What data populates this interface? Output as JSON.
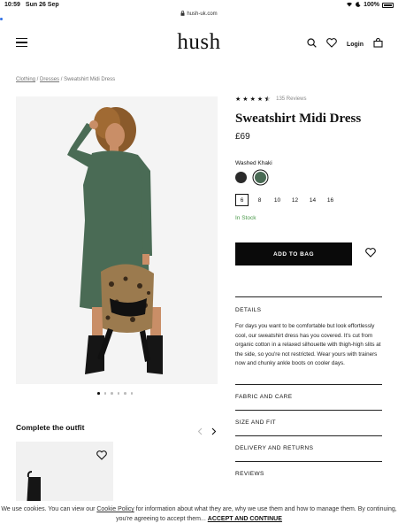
{
  "status": {
    "time": "10:59",
    "date": "Sun 26 Sep",
    "battery": "100%"
  },
  "browser": {
    "url": "hush-uk.com"
  },
  "header": {
    "logo": "hush",
    "login_label": "Login"
  },
  "breadcrumb": {
    "items": [
      "Clothing",
      "Dresses",
      "Sweatshirt Midi Dress"
    ],
    "sep": " / "
  },
  "product": {
    "rating_stars": 4.5,
    "reviews": "135 Reviews",
    "title": "Sweatshirt Midi Dress",
    "price": "£69",
    "color_label": "Washed Khaki",
    "swatch_colors": [
      "#2a2a2a",
      "#4a6b55"
    ],
    "sizes": [
      "6",
      "8",
      "10",
      "12",
      "14",
      "16"
    ],
    "selected_size": "6",
    "stock": "In Stock",
    "add_to_bag": "ADD TO BAG",
    "image_count": 6,
    "image_active": 1
  },
  "accordion": {
    "details_label": "DETAILS",
    "details_text": "For days you want to be comfortable but look effortlessly cool, our sweatshirt dress has you covered. It's cut from organic cotton in a relaxed silhouette with thigh-high slits at the side, so you're not restricted. Wear yours with trainers now and chunky ankle boots on cooler days.",
    "fabric_label": "FABRIC AND CARE",
    "size_label": "SIZE AND FIT",
    "delivery_label": "DELIVERY AND RETURNS",
    "reviews_label": "REVIEWS"
  },
  "outfit": {
    "title": "Complete the outfit"
  },
  "cookie": {
    "text1": "We use cookies. You can view our ",
    "link": "Cookie Policy",
    "text2": " for information about what they are, why we use them and how to manage them. By continuing, you're agreeing to accept them...",
    "accept": "ACCEPT AND CONTINUE"
  },
  "colors": {
    "accent": "#0a0a0a",
    "stock": "#4c9a4c",
    "dress": "#4a6b55"
  }
}
